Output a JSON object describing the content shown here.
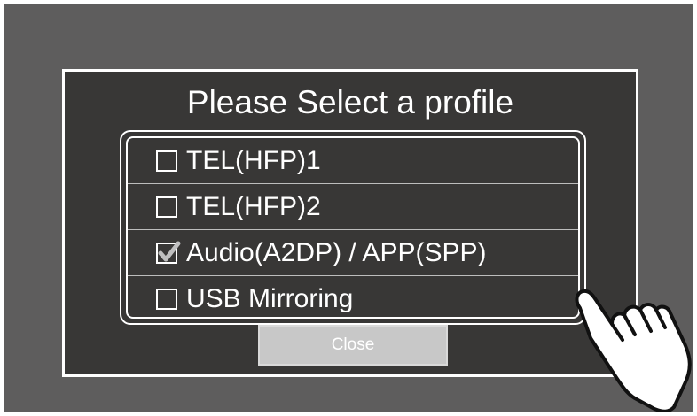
{
  "dialog": {
    "title": "Please Select a profile",
    "close_label": "Close"
  },
  "profiles": [
    {
      "label": "TEL(HFP)1",
      "checked": false
    },
    {
      "label": "TEL(HFP)2",
      "checked": false
    },
    {
      "label": "Audio(A2DP) / APP(SPP)",
      "checked": true
    },
    {
      "label": "USB Mirroring",
      "checked": false
    }
  ],
  "icons": {
    "checkbox": "checkbox-icon",
    "checkmark": "checkmark-icon",
    "hand": "pointing-hand-icon"
  },
  "colors": {
    "screen_bg": "#5e5d5d",
    "dialog_bg": "#383736",
    "text": "#ffffff",
    "close_button": "#c8c8c8",
    "checkmark": "#bfbfbf"
  }
}
